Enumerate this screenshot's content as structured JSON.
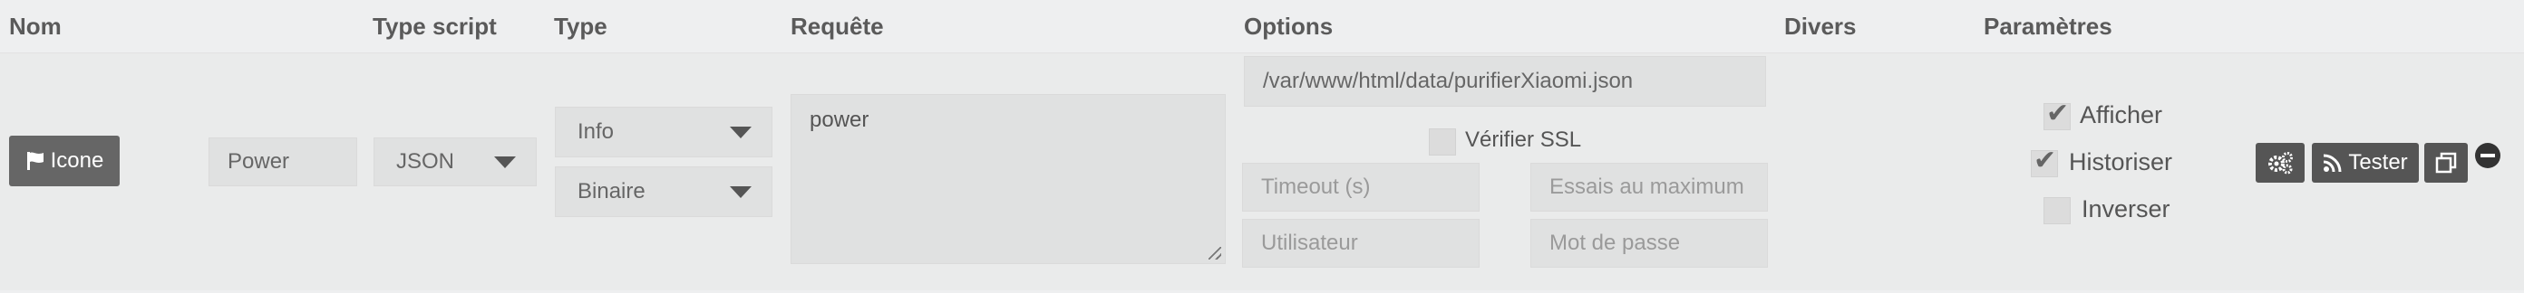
{
  "headers": {
    "nom": "Nom",
    "type_script": "Type script",
    "type": "Type",
    "requete": "Requête",
    "options": "Options",
    "divers": "Divers",
    "parametres": "Paramètres"
  },
  "row": {
    "icon_button_label": "Icone",
    "name_value": "Power",
    "script_type_selected": "JSON",
    "type_selected": "Info",
    "subtype_selected": "Binaire",
    "request_value": "power",
    "options": {
      "path_value": "/var/www/html/data/purifierXiaomi.json",
      "verify_ssl_label": "Vérifier SSL",
      "verify_ssl_checked": false,
      "timeout_placeholder": "Timeout (s)",
      "max_tries_placeholder": "Essais au maximum",
      "user_placeholder": "Utilisateur",
      "password_placeholder": "Mot de passe"
    },
    "params": {
      "afficher_label": "Afficher",
      "afficher_checked": true,
      "historiser_label": "Historiser",
      "historiser_checked": true,
      "inverser_label": "Inverser",
      "inverser_checked": false
    },
    "actions": {
      "test_label": "Tester"
    }
  },
  "icons": {
    "icon_button": "flag-icon",
    "config": "gears-icon",
    "test": "rss-icon",
    "duplicate": "copy-icon",
    "remove": "minus-circle-icon"
  }
}
